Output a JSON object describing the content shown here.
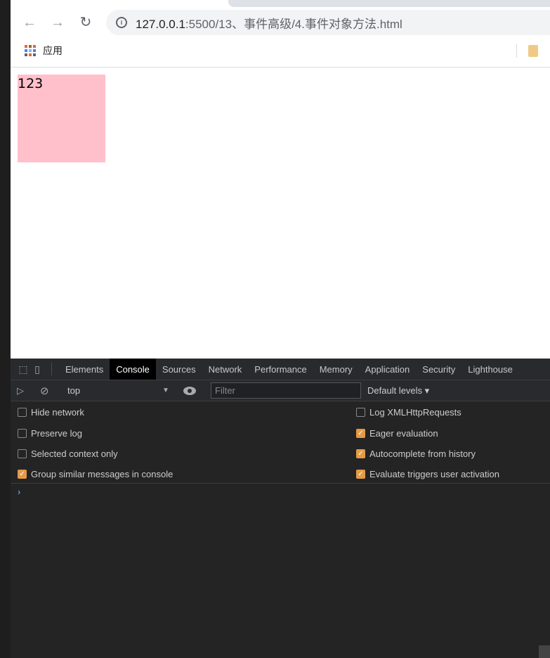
{
  "browser": {
    "url_host": "127.0.0.1",
    "url_rest": ":5500/13、事件高级/4.事件对象方法.html",
    "bookmark_apps": "应用"
  },
  "page": {
    "box_text": "123",
    "box_color": "#ffc0cb"
  },
  "devtools": {
    "tabs": [
      "Elements",
      "Console",
      "Sources",
      "Network",
      "Performance",
      "Memory",
      "Application",
      "Security",
      "Lighthouse"
    ],
    "active_tab": "Console",
    "context": "top",
    "filter_placeholder": "Filter",
    "levels": "Default levels ▾",
    "options_left": [
      {
        "label": "Hide network",
        "checked": false
      },
      {
        "label": "Preserve log",
        "checked": false
      },
      {
        "label": "Selected context only",
        "checked": false
      },
      {
        "label": "Group similar messages in console",
        "checked": true
      }
    ],
    "options_right": [
      {
        "label": "Log XMLHttpRequests",
        "checked": false
      },
      {
        "label": "Eager evaluation",
        "checked": true
      },
      {
        "label": "Autocomplete from history",
        "checked": true
      },
      {
        "label": "Evaluate triggers user activation",
        "checked": true
      }
    ],
    "prompt": "›",
    "accent": "#e59b46"
  }
}
